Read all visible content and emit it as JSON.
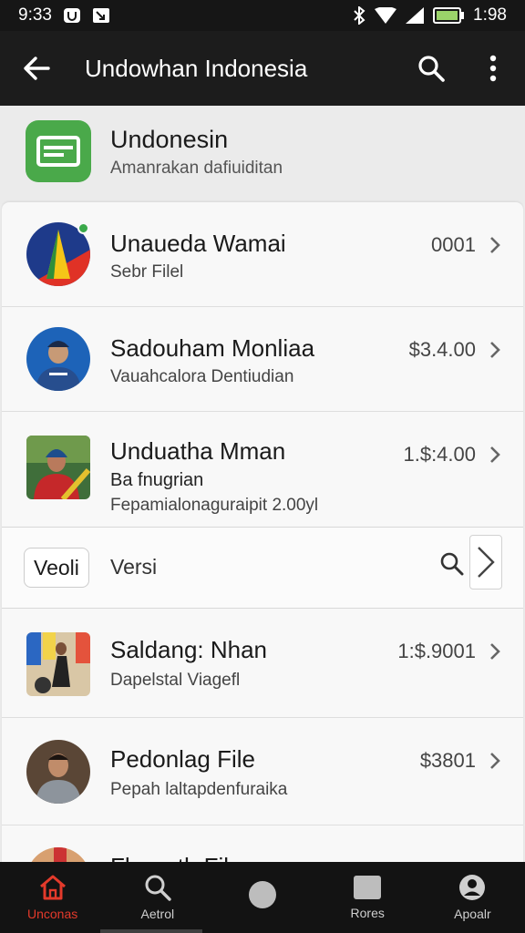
{
  "status_bar": {
    "time": "9:33",
    "battery_time": "1:98"
  },
  "app_bar": {
    "title": "Undowhan Indonesia",
    "back_icon": "arrow-left-icon",
    "search_icon": "search-icon",
    "more_icon": "more-vert-icon"
  },
  "header": {
    "title": "Undonesin",
    "subtitle": "Amanrakan dafiuiditan",
    "icon": "green-card-icon",
    "icon_color": "#4aa94a"
  },
  "rows": [
    {
      "title": "Unaueda Wamai",
      "subtitle": "Sebr Filel",
      "price": "0001"
    },
    {
      "title": "Sadouham Monliaa",
      "subtitle": "Vauahcalora Dentiudian",
      "price": "$3.4.00"
    },
    {
      "title": "Unduatha Mman",
      "subtitle": "Ba fnugrian",
      "subtitle2": "Fepamialonaguraipit 2.00yl",
      "price": "1.$:4.00"
    }
  ],
  "version": {
    "chip_label": "Veoli",
    "label": "Versi"
  },
  "rows2": [
    {
      "title": "Saldang: Nhan",
      "subtitle": "Dapelstal Viagefl",
      "price": "1:$.9001"
    },
    {
      "title": "Pedonlag File",
      "subtitle": "Pepah laltapdenfuraika",
      "price": "$3801"
    },
    {
      "title": "Fhonath File"
    }
  ],
  "bottom_nav": [
    {
      "label": "Unconas",
      "icon": "home-icon",
      "active": true
    },
    {
      "label": "Aetrol",
      "icon": "search-icon",
      "active": false
    },
    {
      "label": "",
      "icon": "circle-icon",
      "active": false
    },
    {
      "label": "Rores",
      "icon": "square-icon",
      "active": false
    },
    {
      "label": "Apoalr",
      "icon": "account-icon",
      "active": false
    }
  ],
  "colors": {
    "accent": "#e43a2b",
    "bar": "#1c1c1c"
  }
}
